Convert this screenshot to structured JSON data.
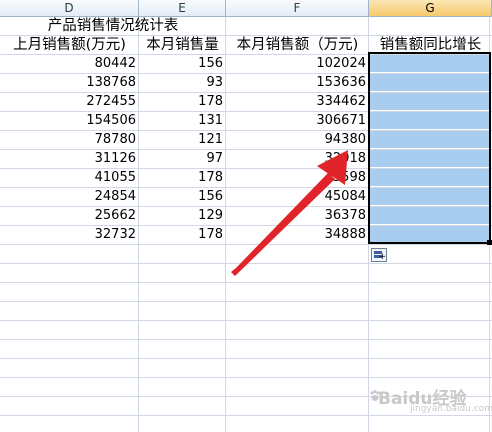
{
  "columns": [
    {
      "id": "col-D",
      "label": "D"
    },
    {
      "id": "col-E",
      "label": "E"
    },
    {
      "id": "col-F",
      "label": "F"
    },
    {
      "id": "col-G",
      "label": "G"
    }
  ],
  "title": "产品销售情况统计表",
  "headers": [
    "上月销售额(万元)",
    "本月销售量",
    "本月销售额（万元)",
    "销售额同比增长"
  ],
  "rows": [
    {
      "d": "80442",
      "e": "156",
      "f": "102024"
    },
    {
      "d": "138768",
      "e": "93",
      "f": "153636"
    },
    {
      "d": "272455",
      "e": "178",
      "f": "334462"
    },
    {
      "d": "154506",
      "e": "131",
      "f": "306671"
    },
    {
      "d": "78780",
      "e": "121",
      "f": "94380"
    },
    {
      "d": "31126",
      "e": "97",
      "f": "32018"
    },
    {
      "d": "41055",
      "e": "178",
      "f": "45598"
    },
    {
      "d": "24854",
      "e": "156",
      "f": "45084"
    },
    {
      "d": "25662",
      "e": "129",
      "f": "36378"
    },
    {
      "d": "32732",
      "e": "178",
      "f": "34888"
    }
  ],
  "watermark": {
    "brand": "Baidu经验",
    "url": "jingyan.baidu.com"
  },
  "colors": {
    "selection_fill": "#a9cdee",
    "arrow": "#e0242a",
    "grid": "#d0d7e5"
  }
}
